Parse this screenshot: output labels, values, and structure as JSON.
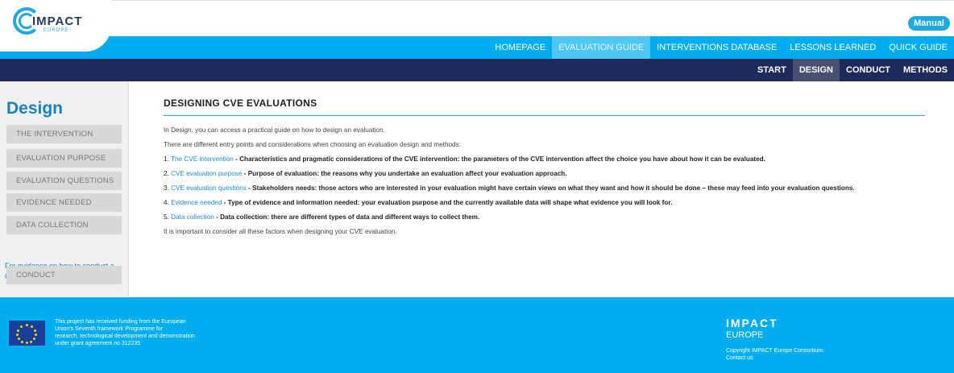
{
  "header": {
    "logo_text": "IMPACT",
    "logo_sub": "EUROPE",
    "manual_label": "Manual"
  },
  "main_nav": [
    {
      "label": "HOMEPAGE",
      "active": false
    },
    {
      "label": "EVALUATION GUIDE",
      "active": true
    },
    {
      "label": "INTERVENTIONS DATABASE",
      "active": false
    },
    {
      "label": "LESSONS LEARNED",
      "active": false
    },
    {
      "label": "QUICK GUIDE",
      "active": false
    }
  ],
  "sub_nav": [
    {
      "label": "START",
      "active": false
    },
    {
      "label": "DESIGN",
      "active": true
    },
    {
      "label": "CONDUCT",
      "active": false
    },
    {
      "label": "METHODS",
      "active": false
    }
  ],
  "sidebar": {
    "title": "Design",
    "items": [
      "THE INTERVENTION",
      "EVALUATION PURPOSE",
      "EVALUATION QUESTIONS",
      "EVIDENCE NEEDED",
      "DATA COLLECTION"
    ],
    "note": "For guidance on how to conduct a CVE evaluation, click here:",
    "conduct_label": "CONDUCT"
  },
  "content": {
    "title": "DESIGNING CVE EVALUATIONS",
    "intro1": "In Design, you can access a practical guide on how to design an evaluation.",
    "intro2": "There are different entry points and considerations when choosing an evaluation design and methods:",
    "items": [
      {
        "num": "1.",
        "link": "The CVE intervention",
        "text": " - Characteristics and pragmatic considerations of the CVE intervention: the parameters of the CVE intervention affect the choice you have about how it can be evaluated."
      },
      {
        "num": "2.",
        "link": "CVE evaluation purpose",
        "text": " - Purpose of evaluation: the reasons why you undertake an evaluation affect your evaluation approach."
      },
      {
        "num": "3.",
        "link": "CVE evaluation questions",
        "text": " - Stakeholders needs: those actors who are interested in your evaluation might have certain views on what they want and how it should be done – these may feed into your evaluation questions."
      },
      {
        "num": "4.",
        "link": "Evidence needed",
        "text": " - Type of evidence and information needed: your evaluation purpose and the currently available data will shape what evidence you will look for."
      },
      {
        "num": "5.",
        "link": "Data collection",
        "text": " - Data collection: there are different types of data and different ways to collect them."
      }
    ],
    "closing": "It is important to consider all these factors when designing your CVE evaluation."
  },
  "footer": {
    "funding_lines": [
      "This project has received funding from the European",
      "Union's Seventh framework Programme for",
      "research, technological development and demonstration",
      "under grant agreement no 312235"
    ],
    "brand": "IMPACT",
    "brand_sub": "EUROPE",
    "copyright": "Copyright IMPACT Europe Consortium.",
    "contact": "Contact us"
  },
  "colors": {
    "primary_blue": "#00aeef",
    "dark_navy": "#1e2a5a",
    "link_blue": "#1a8fd8"
  }
}
